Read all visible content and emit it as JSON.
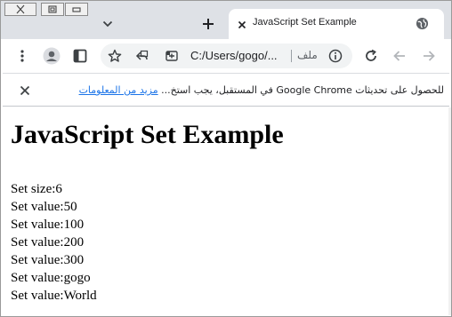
{
  "browser": {
    "tab_title": "JavaScript Set Example",
    "address": "C:/Users/gogo/...",
    "file_label": "ملف",
    "colors": {
      "tabstrip": "#dee1e6",
      "link": "#1a73e8"
    }
  },
  "infobar": {
    "message": "للحصول على تحديثات Google Chrome في المستقبل، يجب استخ...",
    "link": "مزيد من المعلومات"
  },
  "page": {
    "heading": "JavaScript Set Example",
    "lines": [
      "Set size:6",
      "Set value:50",
      "Set value:100",
      "Set value:200",
      "Set value:300",
      "Set value:gogo",
      "Set value:World"
    ]
  }
}
